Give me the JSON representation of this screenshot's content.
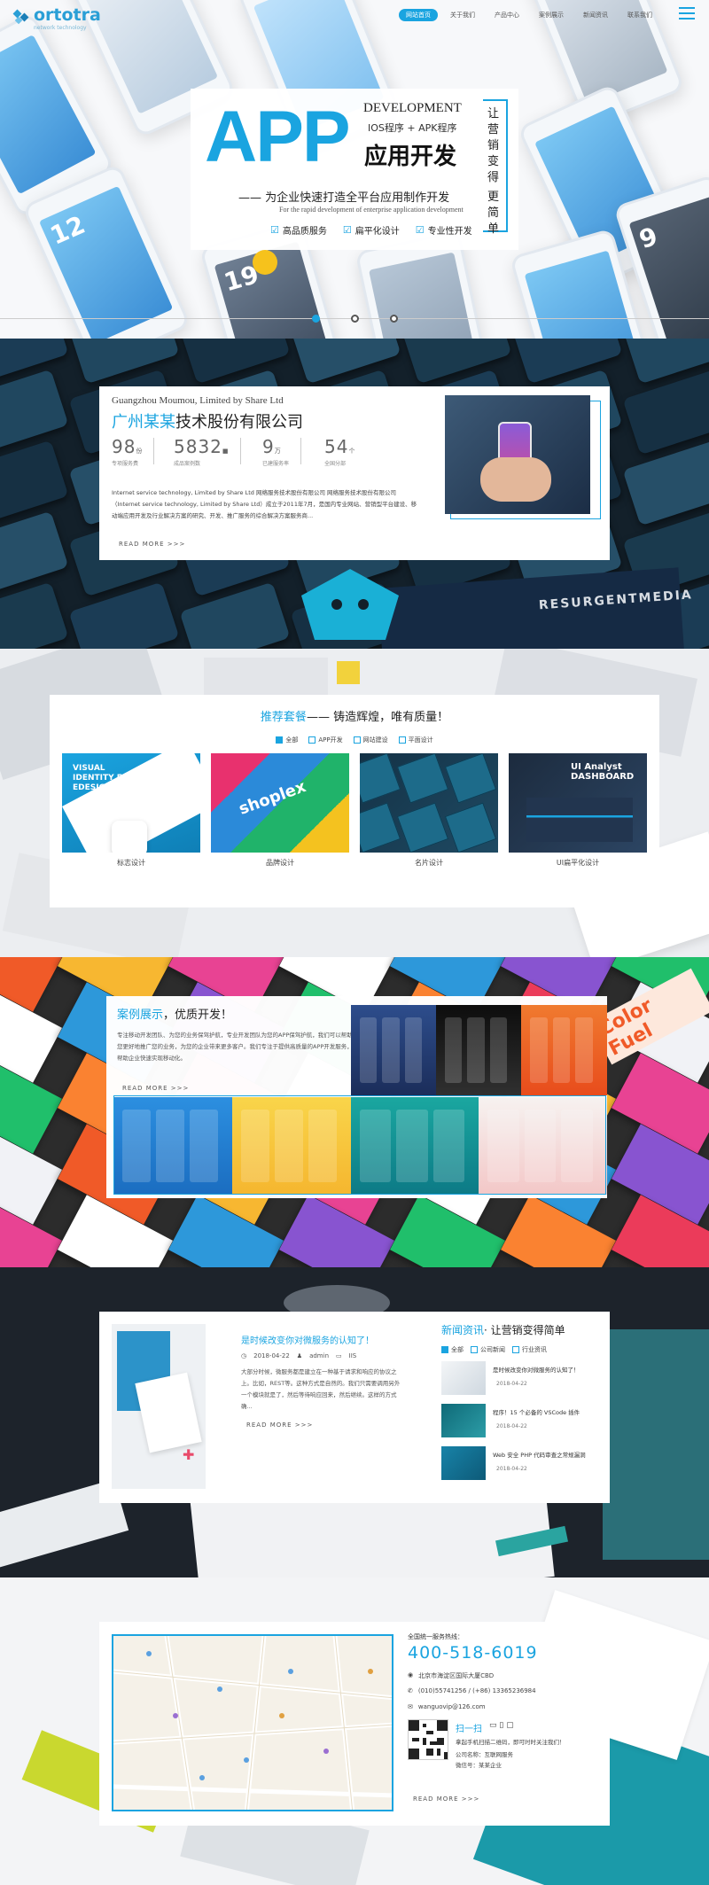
{
  "header": {
    "brand": "ortotra",
    "brand_sub": "network technology",
    "nav": [
      {
        "label": "网站首页",
        "active": true
      },
      {
        "label": "关于我们"
      },
      {
        "label": "产品中心"
      },
      {
        "label": "案例展示"
      },
      {
        "label": "新闻资讯"
      },
      {
        "label": "联系我们"
      }
    ]
  },
  "hero": {
    "big": "APP",
    "development": "DEVELOPMENT",
    "programs": "IOS程序 + APK程序",
    "main": "应用开发",
    "vertical_1": "让营销变得",
    "vertical_2": "更简单",
    "tagline": "—— 为企业快速打造全平台应用制作开发",
    "tagline_en": "For the rapid development of enterprise application development",
    "features": [
      "高品质服务",
      "扁平化设计",
      "专业性开发"
    ],
    "phone_numbers": [
      "12",
      "19",
      "9",
      "12"
    ]
  },
  "about": {
    "company_en": "Guangzhou Moumou, Limited by Share Ltd",
    "company_hl": "广州某某",
    "company_rest": "技术股份有限公司",
    "stats": [
      {
        "value": "98",
        "unit": "份",
        "label": "专项服务费"
      },
      {
        "value": "5832",
        "unit": "■",
        "label": "成品案例数"
      },
      {
        "value": "9",
        "unit": "万",
        "label": "已建服务率"
      },
      {
        "value": "54",
        "unit": "个",
        "label": "全国分部"
      }
    ],
    "desc": "Internet service technology, Limited by Share Ltd 网络服务技术股份有限公司 网络服务技术股份有限公司（Internet service technology, Limited by Share Ltd）成立于2011年7月，是国内专业网站、营销型平台建设、移动端应用开发及行业解决方案的研究、开发、推广服务的综合解决方案服务商...",
    "readmore": "READ MORE >>>",
    "bg_text": "RESURGENTMEDIA"
  },
  "packages": {
    "title_hl": "推荐套餐",
    "title_rest": "—— 铸造辉煌，唯有质量！",
    "tabs": [
      {
        "label": "全部",
        "on": true
      },
      {
        "label": "APP开发"
      },
      {
        "label": "网站建设"
      },
      {
        "label": "平面设计"
      }
    ],
    "items": [
      {
        "caption": "标志设计",
        "art": "VISUAL IDENTITY FOR EDESIGNER"
      },
      {
        "caption": "品牌设计",
        "art": "shoplex"
      },
      {
        "caption": "名片设计",
        "art": ""
      },
      {
        "caption": "UI扁平化设计",
        "art": "UI Analyst DASHBOARD"
      }
    ]
  },
  "cases": {
    "title_hl": "案例展示",
    "title_rest": "，优质开发！",
    "desc": "专注移动开发团队、为您的业务保驾护航，专业开发团队为您的APP保驾护航，我们可以帮助您更好地推广您的业务，为您的企业带来更多客户。我们专注于提供高质量的APP开发服务，帮助企业快速实现移动化。",
    "readmore": "READ MORE >>>",
    "bg_text": "Color Fuel"
  },
  "news": {
    "feature_title": "是时候改变你对微服务的认知了！",
    "feature_date": "2018-04-22",
    "feature_author": "admin",
    "feature_cat": "IIS",
    "feature_desc": "大部分时候，微服务都是建立在一种基于请求和响应的协议之上。比如，REST等。这种方式是自然的。我们只需要调用另外一个模块就是了，然后等待响应回来，然后继续。这样的方式确...",
    "readmore": "READ MORE >>>",
    "section_hl": "新闻资讯",
    "section_rest": "· 让营销变得简单",
    "tabs": [
      {
        "label": "全部",
        "on": true
      },
      {
        "label": "公司新闻"
      },
      {
        "label": "行业资讯"
      }
    ],
    "items": [
      {
        "title": "是时候改变你对微服务的认知了！",
        "date": "2018-04-22"
      },
      {
        "title": "程序！15 个必备的 VSCode 插件",
        "date": "2018-04-22"
      },
      {
        "title": "Web 安全 PHP 代码审查之常规漏洞",
        "date": "2018-04-22"
      }
    ]
  },
  "contact": {
    "hotline_label": "全国统一服务热线：",
    "hotline": "400-518-6019",
    "address": "北京市海淀区国际大厦CBD",
    "phone": "(010)55741256 / (+86) 13365236984",
    "email": "wanguovip@126.com",
    "qr_title": "扫一扫",
    "qr_desc": "拿起手机扫描二维码，即可时时关注我们！",
    "company_label": "公司名称：互联网服务",
    "wechat_label": "微信号：某某企业",
    "readmore": "READ MORE >>>"
  },
  "colors": {
    "accent": "#1aa4e0",
    "dark_bg": "#1f2a33",
    "teal": "#1b9aa9"
  }
}
